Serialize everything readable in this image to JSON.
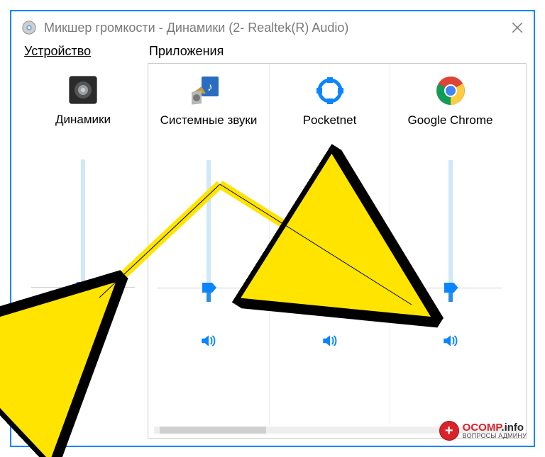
{
  "window": {
    "title": "Микшер громкости - Динамики (2- Realtek(R) Audio)"
  },
  "section": {
    "device": "Устройство",
    "apps": "Приложения"
  },
  "channels": {
    "device": {
      "label": "Динамики",
      "level": 10
    },
    "apps": [
      {
        "label": "Системные звуки",
        "level": 10,
        "icon": "system-sounds-icon"
      },
      {
        "label": "Pocketnet",
        "level": 10,
        "icon": "pocketnet-icon"
      },
      {
        "label": "Google Chrome",
        "level": 10,
        "icon": "chrome-icon"
      }
    ]
  },
  "watermark": {
    "line1a": "OCOMP",
    "line1b": ".info",
    "line2": "ВОПРОСЫ АДМИНУ"
  }
}
